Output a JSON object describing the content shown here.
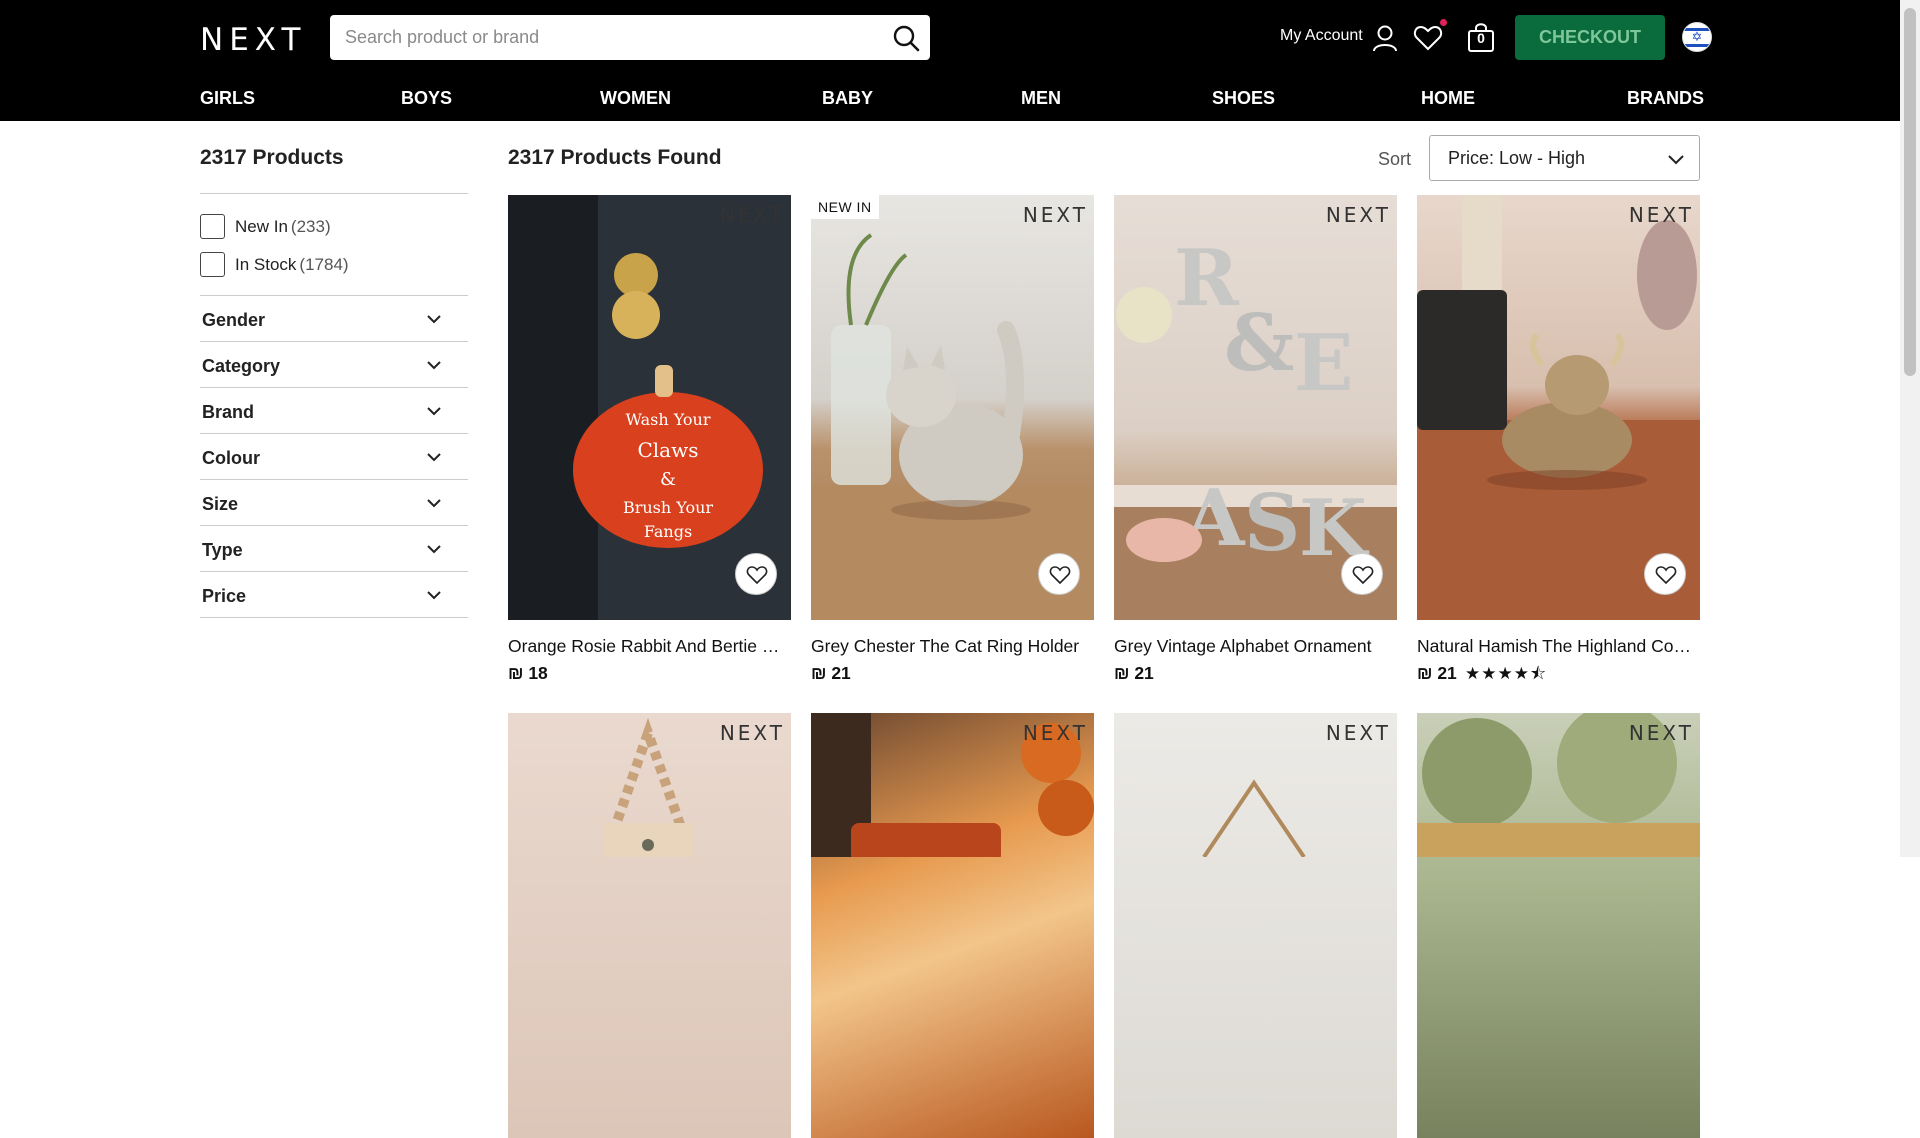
{
  "header": {
    "logo": "NEXT",
    "search_placeholder": "Search product or brand",
    "account_label": "My Account",
    "bag_count": "0",
    "checkout_label": "CHECKOUT"
  },
  "nav": [
    "GIRLS",
    "BOYS",
    "WOMEN",
    "BABY",
    "MEN",
    "SHOES",
    "HOME",
    "BRANDS"
  ],
  "sidebar": {
    "title": "2317 Products",
    "checks": [
      {
        "label": "New In",
        "count": "(233)"
      },
      {
        "label": "In Stock",
        "count": "(1784)"
      }
    ],
    "facets": [
      "Gender",
      "Category",
      "Brand",
      "Colour",
      "Size",
      "Type",
      "Price"
    ]
  },
  "main": {
    "found": "2317 Products Found",
    "sort_label": "Sort",
    "sort_value": "Price: Low - High"
  },
  "products": [
    {
      "brand": "NEXT",
      "title": "Orange Rosie Rabbit And Bertie Bear Wash Your Claws Hanging Plaque",
      "price": "₪ 18",
      "badge": "",
      "stars": ""
    },
    {
      "brand": "NEXT",
      "title": "Grey Chester The Cat Ring Holder",
      "price": "₪ 21",
      "badge": "NEW IN",
      "stars": ""
    },
    {
      "brand": "NEXT",
      "title": "Grey Vintage Alphabet Ornament",
      "price": "₪ 21",
      "badge": "",
      "stars": ""
    },
    {
      "brand": "NEXT",
      "title": "Natural Hamish The Highland Cow Ornament",
      "price": "₪ 21",
      "badge": "",
      "stars": "★★★★⯪"
    },
    {
      "brand": "NEXT"
    },
    {
      "brand": "NEXT"
    },
    {
      "brand": "NEXT"
    },
    {
      "brand": "NEXT"
    }
  ]
}
